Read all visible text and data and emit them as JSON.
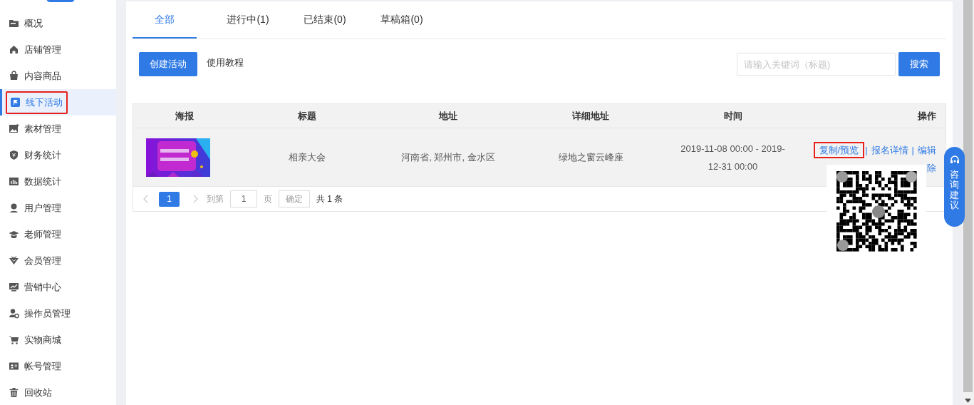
{
  "sidebar": {
    "items": [
      {
        "label": "概况",
        "selected": false,
        "highlighted": false
      },
      {
        "label": "店铺管理",
        "selected": false,
        "highlighted": false
      },
      {
        "label": "内容商品",
        "selected": false,
        "highlighted": false
      },
      {
        "label": "线下活动",
        "selected": true,
        "highlighted": true
      },
      {
        "label": "素材管理",
        "selected": false,
        "highlighted": false
      },
      {
        "label": "财务统计",
        "selected": false,
        "highlighted": false
      },
      {
        "label": "数据统计",
        "selected": false,
        "highlighted": false
      },
      {
        "label": "用户管理",
        "selected": false,
        "highlighted": false
      },
      {
        "label": "老师管理",
        "selected": false,
        "highlighted": false
      },
      {
        "label": "会员管理",
        "selected": false,
        "highlighted": false
      },
      {
        "label": "营销中心",
        "selected": false,
        "highlighted": false
      },
      {
        "label": "操作员管理",
        "selected": false,
        "highlighted": false
      },
      {
        "label": "实物商城",
        "selected": false,
        "highlighted": false
      },
      {
        "label": "帐号管理",
        "selected": false,
        "highlighted": false
      },
      {
        "label": "回收站",
        "selected": false,
        "highlighted": false
      }
    ]
  },
  "tabs": [
    {
      "label": "全部",
      "selected": true
    },
    {
      "label": "进行中(1)",
      "selected": false
    },
    {
      "label": "已结束(0)",
      "selected": false
    },
    {
      "label": "草稿箱(0)",
      "selected": false
    }
  ],
  "toolbar": {
    "create_button": "创建活动",
    "tutorial_link": "使用教程",
    "search": {
      "placeholder": "请输入关键词（标题)"
    },
    "search_button": "搜索"
  },
  "table": {
    "columns": [
      "海报",
      "标题",
      "地址",
      "详细地址",
      "时间",
      "操作"
    ],
    "rows": [
      {
        "poster": {
          "kind": "picture"
        },
        "title": "相亲大会",
        "address": "河南省, 郑州市, 金水区",
        "detail_address": "绿地之窗云峰座",
        "time": "2019-11-08 00:00 - 2019-12-31 00:00",
        "actions": [
          {
            "label": "复制/预览",
            "highlighted": true
          },
          {
            "label": "报名详情",
            "highlighted": false
          },
          {
            "label": "编辑",
            "highlighted": false
          }
        ],
        "action_separator": "|",
        "actions_line2": [
          {
            "label": "除",
            "highlighted": false
          }
        ]
      }
    ]
  },
  "pagination": {
    "pages": [
      {
        "label": "1",
        "selected": true
      }
    ],
    "goto_label": "到第",
    "page_input": "1",
    "page_unit": "页",
    "confirm": "确定",
    "total": "共 1 条"
  },
  "float_button": {
    "label": "咨询建议"
  }
}
